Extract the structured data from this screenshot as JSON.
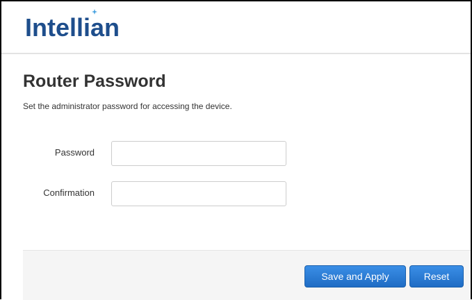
{
  "header": {
    "logo_text": "Intellian"
  },
  "page": {
    "title": "Router Password",
    "description": "Set the administrator password for accessing the device."
  },
  "form": {
    "password": {
      "label": "Password",
      "value": ""
    },
    "confirmation": {
      "label": "Confirmation",
      "value": ""
    }
  },
  "actions": {
    "save_apply_label": "Save and Apply",
    "reset_label": "Reset"
  },
  "colors": {
    "brand": "#1e4e8c",
    "accent": "#2a7bd6",
    "spark": "#4aa3e0"
  }
}
